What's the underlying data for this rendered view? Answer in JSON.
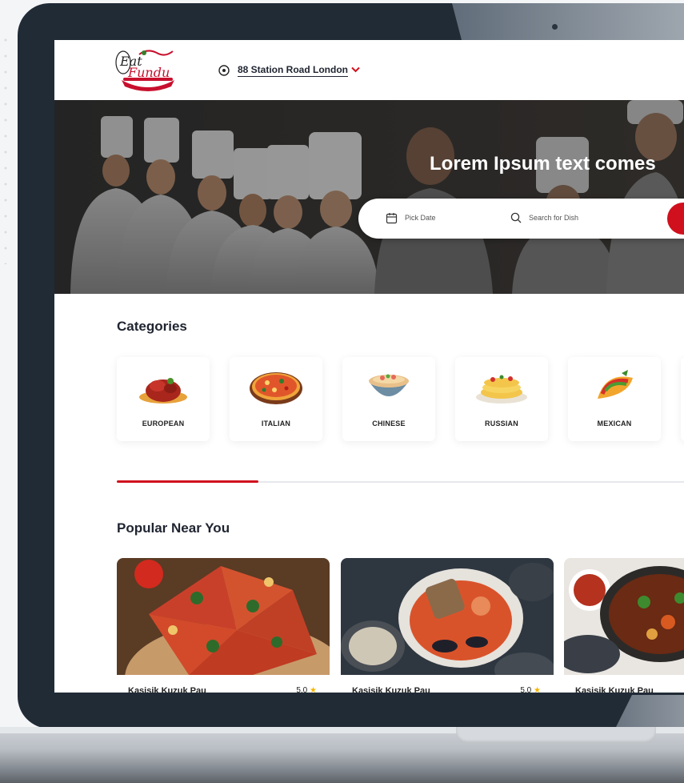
{
  "header": {
    "location": "88 Station Road London"
  },
  "hero": {
    "title": "Lorem Ipsum text comes",
    "date_placeholder": "Pick Date",
    "search_placeholder": "Search for Dish"
  },
  "categories": {
    "title": "Categories",
    "items": [
      {
        "label": "EUROPEAN",
        "icon": "meat-dish-icon"
      },
      {
        "label": "ITALIAN",
        "icon": "pizza-icon"
      },
      {
        "label": "CHINESE",
        "icon": "noodle-bowl-icon"
      },
      {
        "label": "RUSSIAN",
        "icon": "pancake-icon"
      },
      {
        "label": "MEXICAN",
        "icon": "taco-icon"
      }
    ],
    "scroll_progress": 0.25
  },
  "popular": {
    "title": "Popular Near You",
    "cards": [
      {
        "name": "Kasisik Kuzuk Pau",
        "rating": "5.0"
      },
      {
        "name": "Kasisik Kuzuk Pau",
        "rating": "5.0"
      },
      {
        "name": "Kasisik Kuzuk Pau",
        "rating": ""
      }
    ]
  },
  "colors": {
    "accent": "#d0101d",
    "laptop_frame": "#202b36",
    "star": "#f5b400"
  }
}
